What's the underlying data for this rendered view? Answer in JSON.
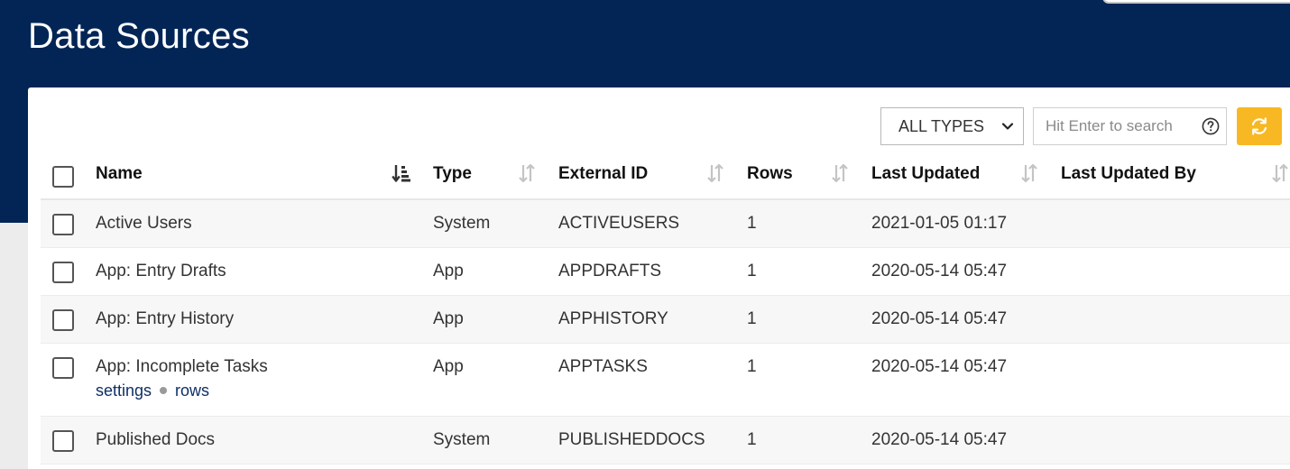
{
  "page": {
    "title": "Data Sources"
  },
  "toolbar": {
    "type_filter": "ALL TYPES",
    "search_placeholder": "Hit Enter to search",
    "help_icon": "question-circle-icon",
    "refresh_icon": "refresh-icon"
  },
  "colors": {
    "header_bg": "#022556",
    "accent": "#f8b823",
    "link": "#0d2f66"
  },
  "table": {
    "columns": [
      {
        "label": "Name",
        "sort": "ascending"
      },
      {
        "label": "Type",
        "sort": "unsorted"
      },
      {
        "label": "External ID",
        "sort": "unsorted"
      },
      {
        "label": "Rows",
        "sort": "unsorted"
      },
      {
        "label": "Last Updated",
        "sort": "unsorted"
      },
      {
        "label": "Last Updated By",
        "sort": "unsorted"
      }
    ],
    "rows": [
      {
        "name": "Active Users",
        "type": "System",
        "external_id": "ACTIVEUSERS",
        "rows": "1",
        "last_updated": "2021-01-05 01:17",
        "last_updated_by": ""
      },
      {
        "name": "App: Entry Drafts",
        "type": "App",
        "external_id": "APPDRAFTS",
        "rows": "1",
        "last_updated": "2020-05-14 05:47",
        "last_updated_by": ""
      },
      {
        "name": "App: Entry History",
        "type": "App",
        "external_id": "APPHISTORY",
        "rows": "1",
        "last_updated": "2020-05-14 05:47",
        "last_updated_by": ""
      },
      {
        "name": "App: Incomplete Tasks",
        "type": "App",
        "external_id": "APPTASKS",
        "rows": "1",
        "last_updated": "2020-05-14 05:47",
        "last_updated_by": "",
        "links": [
          "settings",
          "rows"
        ]
      },
      {
        "name": "Published Docs",
        "type": "System",
        "external_id": "PUBLISHEDDOCS",
        "rows": "1",
        "last_updated": "2020-05-14 05:47",
        "last_updated_by": ""
      }
    ]
  }
}
